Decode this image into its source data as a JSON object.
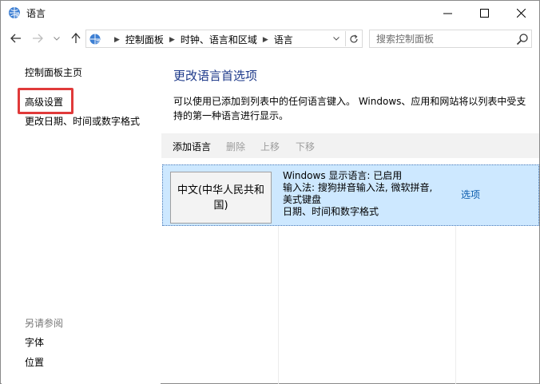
{
  "window": {
    "title": "语言"
  },
  "address_bar": {
    "breadcrumbs": [
      "控制面板",
      "时钟、语言和区域",
      "语言"
    ]
  },
  "search": {
    "placeholder": "搜索控制面板"
  },
  "left_pane": {
    "home_link": "控制面板主页",
    "advanced_link": "高级设置",
    "datetime_link": "更改日期、时间或数字格式",
    "see_also_heading": "另请参阅",
    "fonts_link": "字体",
    "location_link": "位置"
  },
  "main": {
    "title": "更改语言首选项",
    "description": "可以使用已添加到列表中的任何语言键入。 Windows、应用和网站将以列表中受支持的第一种语言进行显示。",
    "toolbar": {
      "add": "添加语言",
      "remove": "删除",
      "move_up": "上移",
      "move_down": "下移"
    },
    "languages": [
      {
        "name": "中文(中华人民共和国)",
        "display_language": "Windows 显示语言: 已启用",
        "input_method_line1": "输入法: 搜狗拼音输入法, 微软拼音,",
        "input_method_line2": "美式键盘",
        "date_time": "日期、时间和数字格式",
        "options_label": "选项"
      }
    ]
  },
  "colors": {
    "title_blue": "#1e3a8a",
    "link_blue": "#0b5cad",
    "selected_row": "#cde8ff",
    "highlight_red": "#e03a3a"
  }
}
